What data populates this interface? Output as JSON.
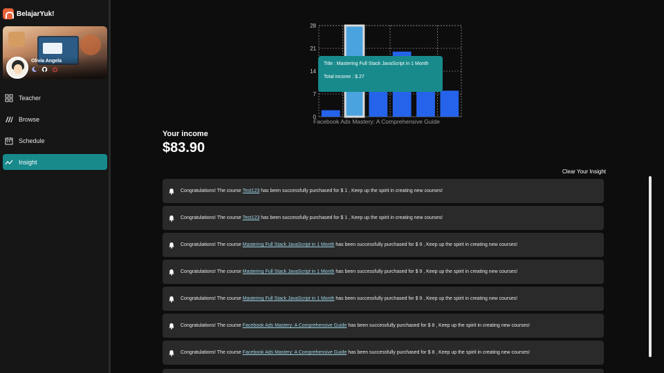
{
  "app": {
    "name": "BelajarYuk!"
  },
  "user": {
    "name": "Olivia Angela",
    "icons": [
      "moon-icon",
      "github-icon",
      "power-icon"
    ]
  },
  "nav": {
    "items": [
      {
        "label": "Teacher",
        "icon": "dashboard-grid-icon",
        "active": false
      },
      {
        "label": "Browse",
        "icon": "browse-stripes-icon",
        "active": false
      },
      {
        "label": "Schedule",
        "icon": "calendar-icon",
        "active": false
      },
      {
        "label": "Insight",
        "icon": "trend-line-icon",
        "active": true
      }
    ]
  },
  "chart_data": {
    "type": "bar",
    "categories": [
      "Facebook Ads Mastery: A Comprehensive Guide",
      "Mastering Full Stack JavaScript in 1 Month",
      "",
      "",
      "",
      ""
    ],
    "values": [
      2,
      28,
      8,
      20,
      8,
      8
    ],
    "ylim": [
      0,
      28
    ],
    "yticks": [
      "0",
      "7",
      "14",
      "21",
      "28"
    ],
    "xlabel": "Facebook Ads Mastery: A Comprehensive Guide",
    "grid": true,
    "highlight_index": 1,
    "colors": {
      "bar": "#2563eb",
      "highlight": "#4aa3df",
      "highlight_border": "#d9d9d9",
      "grid": "#bbbbbb"
    }
  },
  "tooltip": {
    "title_line": "Title : Mastering Full Stack JavaScript in 1 Month",
    "income_line": "Total income : $.27"
  },
  "income": {
    "label": "Your income",
    "value": "$83.90"
  },
  "clear_label": "Clear Your Insight",
  "notifications": [
    {
      "prefix": "Congratulations! The course",
      "course": "Test123",
      "suffix": "has been successfully purchased for $ 1 , Keep up the spirit in creating new courses!"
    },
    {
      "prefix": "Congratulations! The course",
      "course": "Test123",
      "suffix": "has been successfully purchased for $ 1 , Keep up the spirit in creating new courses!"
    },
    {
      "prefix": "Congratulations! The course",
      "course": "Mastering Full Stack JavaScript in 1 Month",
      "suffix": "has been successfully purchased for $ 9 , Keep up the spirit in creating new courses!"
    },
    {
      "prefix": "Congratulations! The course",
      "course": "Mastering Full Stack JavaScript in 1 Month",
      "suffix": "has been successfully purchased for $ 9 , Keep up the spirit in creating new courses!"
    },
    {
      "prefix": "Congratulations! The course",
      "course": "Mastering Full Stack JavaScript in 1 Month",
      "suffix": "has been successfully purchased for $ 9 , Keep up the spirit in creating new courses!"
    },
    {
      "prefix": "Congratulations! The course",
      "course": "Facebook Ads Mastery: A Comprehensive Guide",
      "suffix": "has been successfully purchased for $ 8 , Keep up the spirit in creating new courses!"
    },
    {
      "prefix": "Congratulations! The course",
      "course": "Facebook Ads Mastery: A Comprehensive Guide",
      "suffix": "has been successfully purchased for $ 8 , Keep up the spirit in creating new courses!"
    }
  ]
}
